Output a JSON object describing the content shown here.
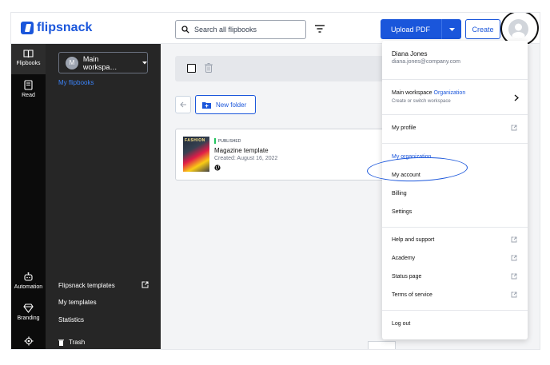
{
  "app": {
    "logo_text": "flipsnack",
    "brand_color": "#1a56db"
  },
  "header": {
    "search_placeholder": "Search all flipbooks",
    "upload_label": "Upload PDF",
    "create_label": "Create"
  },
  "rail": {
    "items": [
      {
        "label": "Flipbooks",
        "icon": "flipbooks-icon"
      },
      {
        "label": "Read",
        "icon": "read-icon"
      },
      {
        "label": "Automation",
        "icon": "automation-icon"
      },
      {
        "label": "Branding",
        "icon": "branding-icon"
      }
    ]
  },
  "panel": {
    "workspace_initial": "M",
    "workspace_label": "Main workspa…",
    "my_flipbooks": "My flipbooks",
    "templates": "Flipsnack templates",
    "my_templates": "My templates",
    "statistics": "Statistics",
    "trash": "Trash"
  },
  "main": {
    "new_folder": "New folder",
    "flipbook": {
      "status": "PUBLISHED",
      "title": "Magazine template",
      "created": "Created: August 16, 2022",
      "cover_text": "FASHION"
    }
  },
  "menu": {
    "name": "Diana Jones",
    "email": "diana.jones@company.com",
    "workspace": "Main workspace",
    "workspace_type": "Organization",
    "workspace_sub": "Create or switch workspace",
    "my_profile": "My profile",
    "my_organization": "My organization",
    "my_account": "My account",
    "billing": "Billing",
    "settings": "Settings",
    "help": "Help and support",
    "academy": "Academy",
    "status": "Status page",
    "terms": "Terms of service",
    "logout": "Log out"
  }
}
